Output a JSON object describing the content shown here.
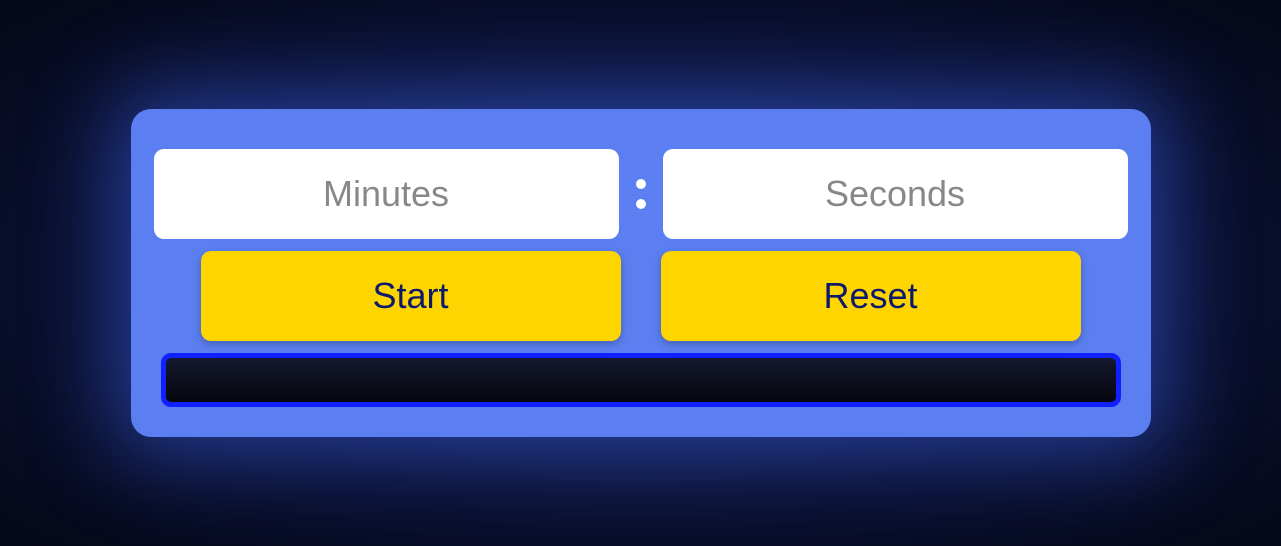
{
  "inputs": {
    "minutes": {
      "placeholder": "Minutes",
      "value": ""
    },
    "seconds": {
      "placeholder": "Seconds",
      "value": ""
    }
  },
  "buttons": {
    "start_label": "Start",
    "reset_label": "Reset"
  },
  "display": {
    "value": ""
  }
}
